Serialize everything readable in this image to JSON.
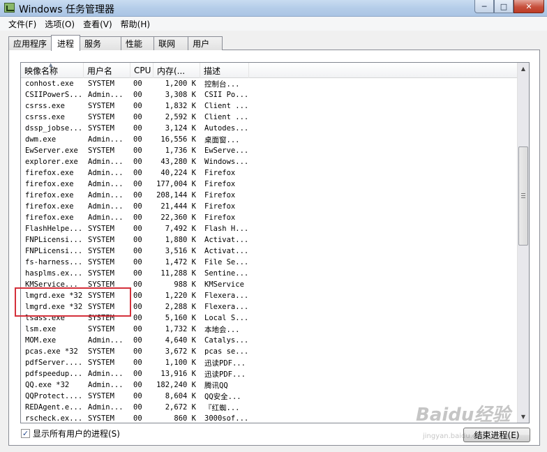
{
  "window": {
    "title": "Windows 任务管理器",
    "controls": {
      "minimize": "─",
      "maximize": "□",
      "close": "✕"
    }
  },
  "menu": [
    "文件(F)",
    "选项(O)",
    "查看(V)",
    "帮助(H)"
  ],
  "tabs": [
    {
      "label": "应用程序",
      "active": false
    },
    {
      "label": "进程",
      "active": true
    },
    {
      "label": "服务",
      "active": false
    },
    {
      "label": "性能",
      "active": false
    },
    {
      "label": "联网",
      "active": false
    },
    {
      "label": "用户",
      "active": false
    }
  ],
  "columns": [
    {
      "label": "映像名称",
      "width": 90
    },
    {
      "label": "用户名",
      "width": 67
    },
    {
      "label": "CPU",
      "width": 33
    },
    {
      "label": "内存(...",
      "width": 67
    },
    {
      "label": "描述",
      "width": 70
    }
  ],
  "processes": [
    {
      "name": "conhost.exe",
      "user": "SYSTEM",
      "cpu": "00",
      "mem": "1,200 K",
      "desc": "控制台..."
    },
    {
      "name": "CSIIPowerS...",
      "user": "Admin...",
      "cpu": "00",
      "mem": "3,308 K",
      "desc": "CSII Po..."
    },
    {
      "name": "csrss.exe",
      "user": "SYSTEM",
      "cpu": "00",
      "mem": "1,832 K",
      "desc": "Client ..."
    },
    {
      "name": "csrss.exe",
      "user": "SYSTEM",
      "cpu": "00",
      "mem": "2,592 K",
      "desc": "Client ..."
    },
    {
      "name": "dssp_jobse...",
      "user": "SYSTEM",
      "cpu": "00",
      "mem": "3,124 K",
      "desc": "Autodes..."
    },
    {
      "name": "dwm.exe",
      "user": "Admin...",
      "cpu": "00",
      "mem": "16,556 K",
      "desc": "桌面窗..."
    },
    {
      "name": "EwServer.exe",
      "user": "SYSTEM",
      "cpu": "00",
      "mem": "1,736 K",
      "desc": "EwServe..."
    },
    {
      "name": "explorer.exe",
      "user": "Admin...",
      "cpu": "00",
      "mem": "43,280 K",
      "desc": "Windows..."
    },
    {
      "name": "firefox.exe",
      "user": "Admin...",
      "cpu": "00",
      "mem": "40,224 K",
      "desc": "Firefox"
    },
    {
      "name": "firefox.exe",
      "user": "Admin...",
      "cpu": "00",
      "mem": "177,004 K",
      "desc": "Firefox"
    },
    {
      "name": "firefox.exe",
      "user": "Admin...",
      "cpu": "00",
      "mem": "208,144 K",
      "desc": "Firefox"
    },
    {
      "name": "firefox.exe",
      "user": "Admin...",
      "cpu": "00",
      "mem": "21,444 K",
      "desc": "Firefox"
    },
    {
      "name": "firefox.exe",
      "user": "Admin...",
      "cpu": "00",
      "mem": "22,360 K",
      "desc": "Firefox"
    },
    {
      "name": "FlashHelpe...",
      "user": "SYSTEM",
      "cpu": "00",
      "mem": "7,492 K",
      "desc": "Flash H..."
    },
    {
      "name": "FNPLicensi...",
      "user": "SYSTEM",
      "cpu": "00",
      "mem": "1,880 K",
      "desc": "Activat..."
    },
    {
      "name": "FNPLicensi...",
      "user": "SYSTEM",
      "cpu": "00",
      "mem": "3,516 K",
      "desc": "Activat..."
    },
    {
      "name": "fs-harness...",
      "user": "SYSTEM",
      "cpu": "00",
      "mem": "1,472 K",
      "desc": "File Se..."
    },
    {
      "name": "hasplms.ex...",
      "user": "SYSTEM",
      "cpu": "00",
      "mem": "11,288 K",
      "desc": "Sentine..."
    },
    {
      "name": "KMService...",
      "user": "SYSTEM",
      "cpu": "00",
      "mem": "988 K",
      "desc": "KMService"
    },
    {
      "name": "lmgrd.exe *32",
      "user": "SYSTEM",
      "cpu": "00",
      "mem": "1,220 K",
      "desc": "Flexera..."
    },
    {
      "name": "lmgrd.exe *32",
      "user": "SYSTEM",
      "cpu": "00",
      "mem": "2,288 K",
      "desc": "Flexera..."
    },
    {
      "name": "lsass.exe",
      "user": "SYSTEM",
      "cpu": "00",
      "mem": "5,160 K",
      "desc": "Local S..."
    },
    {
      "name": "lsm.exe",
      "user": "SYSTEM",
      "cpu": "00",
      "mem": "1,732 K",
      "desc": "本地会..."
    },
    {
      "name": "MOM.exe",
      "user": "Admin...",
      "cpu": "00",
      "mem": "4,640 K",
      "desc": "Catalys..."
    },
    {
      "name": "pcas.exe *32",
      "user": "SYSTEM",
      "cpu": "00",
      "mem": "3,672 K",
      "desc": "pcas se..."
    },
    {
      "name": "pdfServer....",
      "user": "SYSTEM",
      "cpu": "00",
      "mem": "1,100 K",
      "desc": "迅读PDF..."
    },
    {
      "name": "pdfspeedup...",
      "user": "Admin...",
      "cpu": "00",
      "mem": "13,916 K",
      "desc": "迅读PDF..."
    },
    {
      "name": "QQ.exe *32",
      "user": "Admin...",
      "cpu": "00",
      "mem": "182,240 K",
      "desc": "腾讯QQ"
    },
    {
      "name": "QQProtect....",
      "user": "SYSTEM",
      "cpu": "00",
      "mem": "8,604 K",
      "desc": "QQ安全..."
    },
    {
      "name": "REDAgent.e...",
      "user": "Admin...",
      "cpu": "00",
      "mem": "2,672 K",
      "desc": "『红蜘..."
    },
    {
      "name": "rscheck.ex...",
      "user": "SYSTEM",
      "cpu": "00",
      "mem": "860 K",
      "desc": "3000sof..."
    }
  ],
  "show_all_users": {
    "label": "显示所有用户的进程(S)",
    "checked": true
  },
  "end_process_button": "结束进程(E)",
  "watermark": {
    "logo": "Baidu经验",
    "url": "jingyan.baidu.com"
  },
  "colors": {
    "highlight": "#d4303a",
    "titlebar": "#b9d1ea"
  }
}
